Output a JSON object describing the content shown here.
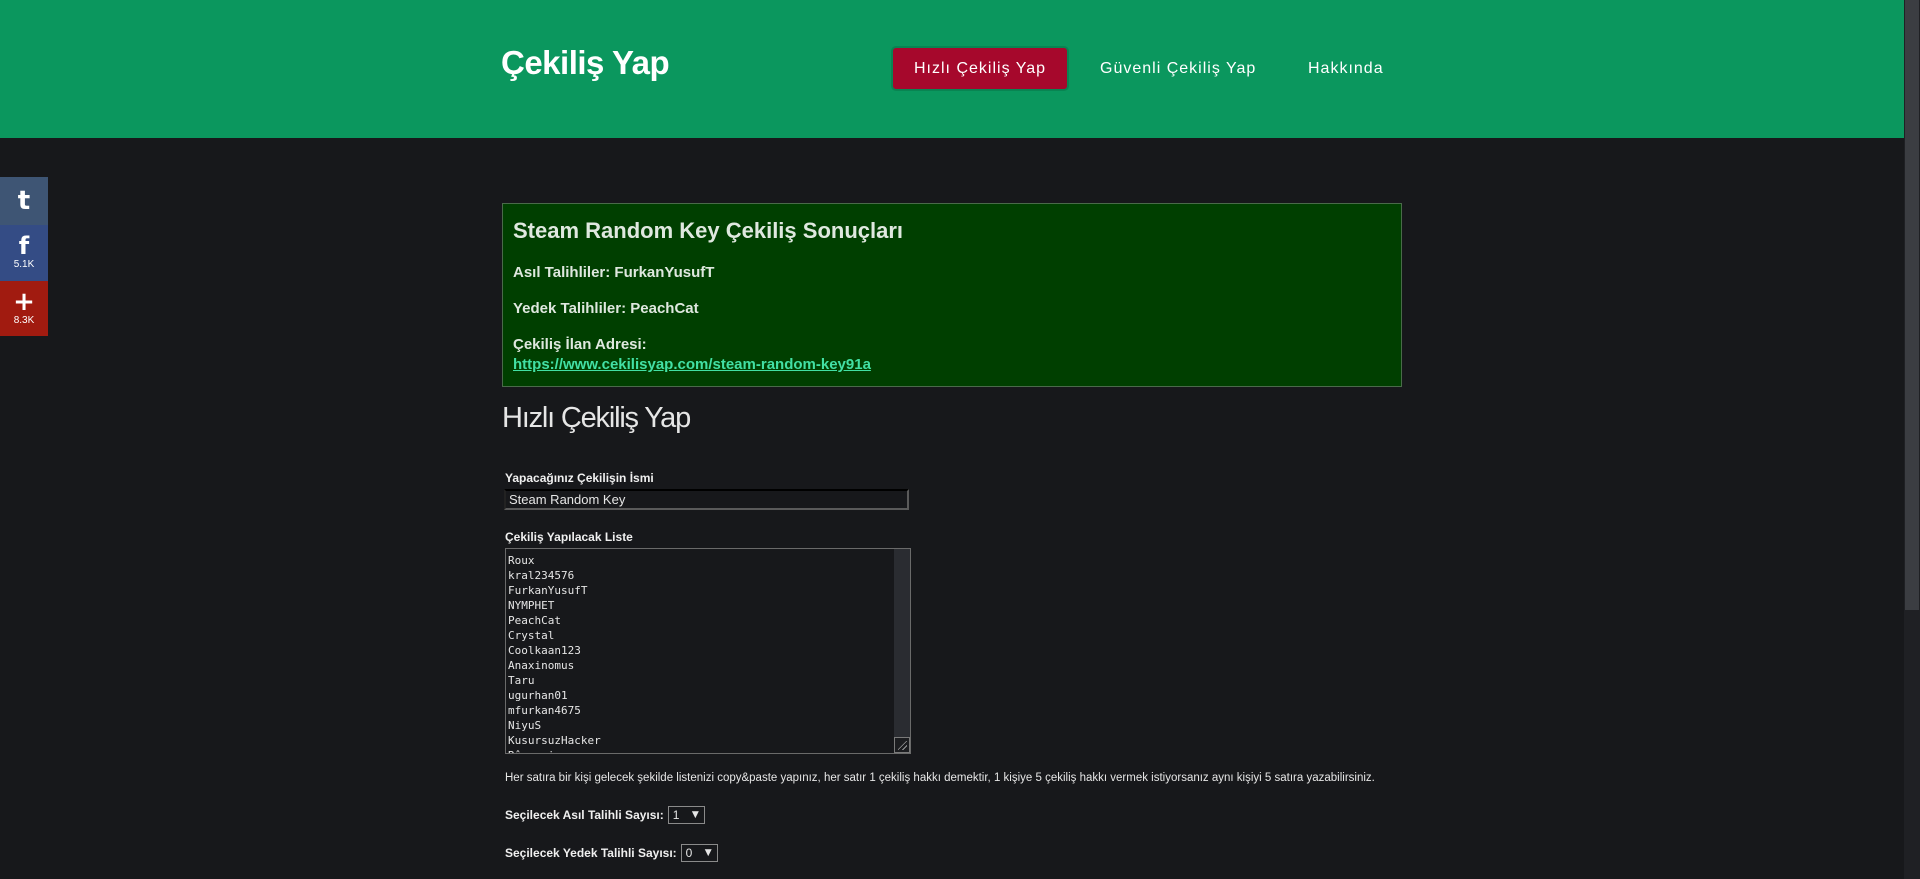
{
  "header": {
    "brand": "Çekiliş Yap",
    "nav": [
      {
        "label": "Hızlı Çekiliş Yap",
        "active": true
      },
      {
        "label": "Güvenli Çekiliş Yap",
        "active": false
      },
      {
        "label": "Hakkında",
        "active": false
      }
    ],
    "bg_color": "#0b975e",
    "active_color": "#a6082c"
  },
  "share": {
    "tumblr": {
      "glyph": "t",
      "icon": "tumblr-icon"
    },
    "facebook": {
      "glyph": "f",
      "count": "5.1K",
      "icon": "facebook-icon"
    },
    "more": {
      "glyph": "+",
      "count": "8.3K",
      "icon": "plus-icon"
    }
  },
  "results": {
    "title": "Steam Random Key Çekiliş Sonuçları",
    "winners_line": "Asıl Talihliler: FurkanYusufT",
    "backups_line": "Yedek Talihliler: PeachCat",
    "address_label": "Çekiliş İlan Adresi:",
    "address_url": "https://www.cekilisyap.com/steam-random-key91a",
    "bg_color": "#003f00",
    "link_color": "#42e0a4"
  },
  "form": {
    "title": "Hızlı Çekiliş Yap",
    "name_label": "Yapacağınız Çekilişin İsmi",
    "name_value": "Steam Random Key",
    "list_label": "Çekiliş Yapılacak Liste",
    "list_entries": [
      "Roux",
      "kral234576",
      "FurkanYusufT",
      "NYMPHET",
      "PeachCat",
      "Crystal",
      "Coolkaan123",
      "Anaxinomus",
      "Taru",
      "ugurhan01",
      "mfurkan4675",
      "NiyuS",
      "KusursuzHacker",
      "Rûyşamira"
    ],
    "help_text": "Her satıra bir kişi gelecek şekilde listenizi copy&paste yapınız, her satır 1 çekiliş hakkı demektir, 1 kişiye 5 çekiliş hakkı vermek istiyorsanız aynı kişiyi 5 satıra yazabilirsiniz.",
    "main_winners_label": "Seçilecek Asıl Talihli Sayısı:",
    "main_winners_value": "1",
    "backup_winners_label": "Seçilecek Yedek Talihli Sayısı:",
    "backup_winners_value": "0"
  }
}
